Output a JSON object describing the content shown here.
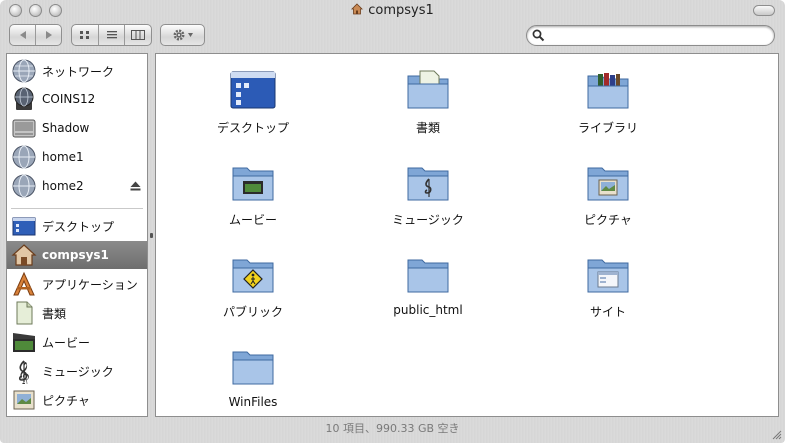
{
  "window": {
    "title": "compsys1"
  },
  "search": {
    "value": "",
    "placeholder": ""
  },
  "sidebar": {
    "devices": [
      {
        "label": "ネットワーク",
        "icon": "network-globe-icon"
      },
      {
        "label": "COINS12",
        "icon": "server-icon"
      },
      {
        "label": "Shadow",
        "icon": "hard-drive-icon"
      },
      {
        "label": "home1",
        "icon": "network-globe-icon"
      },
      {
        "label": "home2",
        "icon": "network-globe-icon",
        "ejectable": true
      }
    ],
    "places": [
      {
        "label": "デスクトップ",
        "icon": "desktop-icon",
        "selected": false
      },
      {
        "label": "compsys1",
        "icon": "home-icon",
        "selected": true
      },
      {
        "label": "アプリケーション",
        "icon": "applications-icon",
        "selected": false
      },
      {
        "label": "書類",
        "icon": "documents-icon",
        "selected": false
      },
      {
        "label": "ムービー",
        "icon": "movies-icon",
        "selected": false
      },
      {
        "label": "ミュージック",
        "icon": "music-icon",
        "selected": false
      },
      {
        "label": "ピクチャ",
        "icon": "pictures-icon",
        "selected": false
      }
    ]
  },
  "files": [
    {
      "label": "デスクトップ",
      "icon": "desktop-folder-icon"
    },
    {
      "label": "書類",
      "icon": "documents-folder-icon"
    },
    {
      "label": "ライブラリ",
      "icon": "library-folder-icon"
    },
    {
      "label": "ムービー",
      "icon": "movies-folder-icon"
    },
    {
      "label": "ミュージック",
      "icon": "music-folder-icon"
    },
    {
      "label": "ピクチャ",
      "icon": "pictures-folder-icon"
    },
    {
      "label": "パブリック",
      "icon": "public-folder-icon"
    },
    {
      "label": "public_html",
      "icon": "folder-icon"
    },
    {
      "label": "サイト",
      "icon": "sites-folder-icon"
    },
    {
      "label": "WinFiles",
      "icon": "folder-icon"
    }
  ],
  "status": {
    "text": "10 項目、990.33 GB 空き"
  },
  "colors": {
    "selection": "#7d7d7d",
    "folder": "#7fa6d6"
  }
}
